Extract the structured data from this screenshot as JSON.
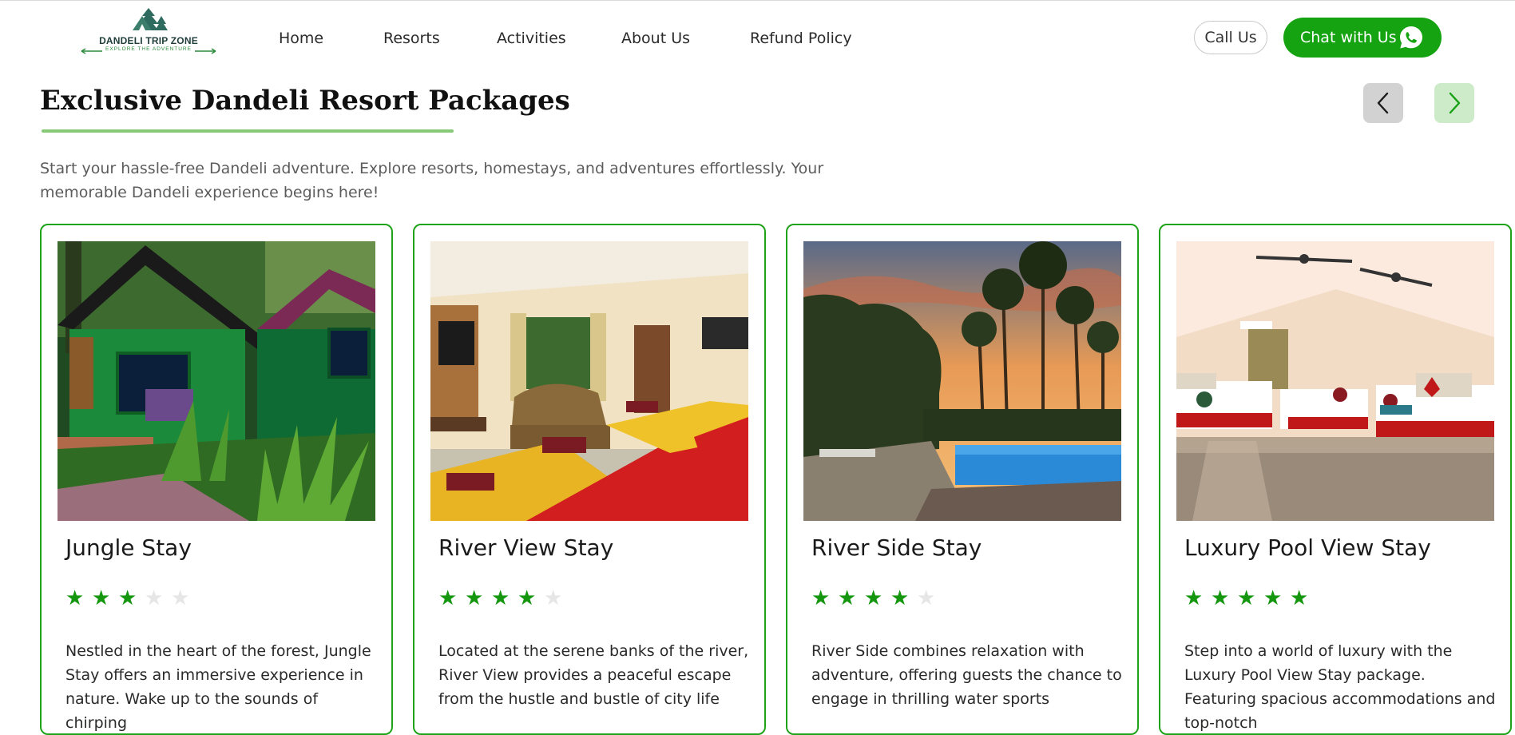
{
  "brand": {
    "name": "DANDELI TRIP ZONE",
    "tagline": "EXPLORE THE ADVENTURE"
  },
  "nav": [
    {
      "label": "Home"
    },
    {
      "label": "Resorts"
    },
    {
      "label": "Activities"
    },
    {
      "label": "About Us"
    },
    {
      "label": "Refund Policy"
    }
  ],
  "actions": {
    "call_label": "Call Us",
    "chat_label": "Chat with Us",
    "chat_icon": "whatsapp-icon"
  },
  "section": {
    "title": "Exclusive Dandeli Resort Packages",
    "subtitle": "Start your hassle-free Dandeli adventure. Explore resorts, homestays, and adventures effortlessly. Your memorable Dandeli experience begins here!",
    "prev_icon": "chevron-left-icon",
    "next_icon": "chevron-right-icon"
  },
  "cards": [
    {
      "title": "Jungle Stay",
      "rating": 3,
      "rating_max": 5,
      "image": "green-jungle-cottages",
      "description": "Nestled in the heart of the forest, Jungle Stay offers an immersive experience in nature. Wake up to the sounds of chirping"
    },
    {
      "title": "River View Stay",
      "rating": 4,
      "rating_max": 5,
      "image": "room-with-beds-and-sofa",
      "description": "Located at the serene banks of the river, River View provides a peaceful escape from the hustle and bustle of city life"
    },
    {
      "title": "River Side Stay",
      "rating": 4,
      "rating_max": 5,
      "image": "pool-at-sunset-with-palms",
      "description": "River Side combines relaxation with adventure, offering guests the chance to engage in thrilling water sports"
    },
    {
      "title": "Luxury Pool View Stay",
      "rating": 5,
      "rating_max": 5,
      "image": "luxury-room-with-three-beds",
      "description": "Step into a world of luxury with the Luxury Pool View Stay package. Featuring spacious accommodations and top-notch"
    }
  ],
  "colors": {
    "accent": "#15a312",
    "star_on": "#14960f",
    "star_off": "#e6e6e6",
    "underline": "#88c978"
  }
}
